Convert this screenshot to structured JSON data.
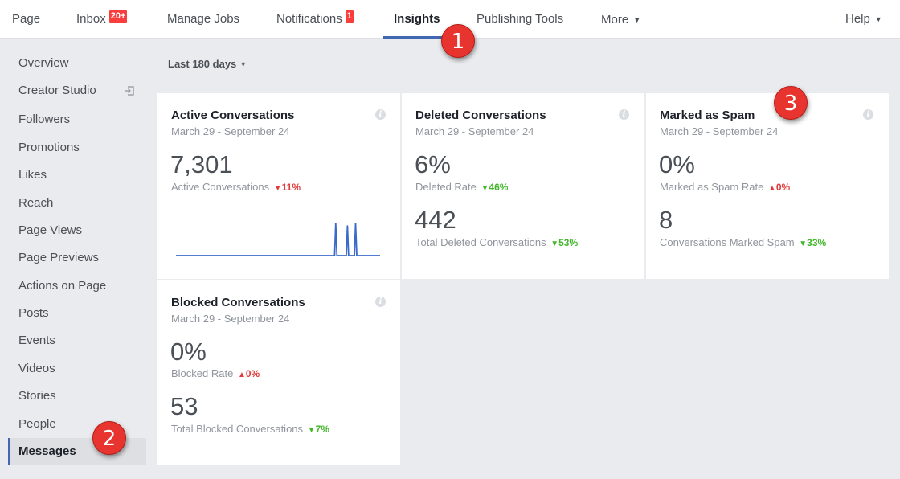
{
  "topnav": {
    "items": [
      {
        "label": "Page"
      },
      {
        "label": "Inbox",
        "badge": "20+"
      },
      {
        "label": "Manage Jobs"
      },
      {
        "label": "Notifications",
        "badge": "1"
      },
      {
        "label": "Insights",
        "active": true
      },
      {
        "label": "Publishing Tools"
      },
      {
        "label": "More"
      }
    ],
    "help": "Help"
  },
  "annotations": [
    "1",
    "2",
    "3"
  ],
  "sidebar": {
    "items": [
      {
        "label": "Overview"
      },
      {
        "label": "Creator Studio"
      },
      {
        "label": "Followers"
      },
      {
        "label": "Promotions"
      },
      {
        "label": "Likes"
      },
      {
        "label": "Reach"
      },
      {
        "label": "Page Views"
      },
      {
        "label": "Page Previews"
      },
      {
        "label": "Actions on Page"
      },
      {
        "label": "Posts"
      },
      {
        "label": "Events"
      },
      {
        "label": "Videos"
      },
      {
        "label": "Stories"
      },
      {
        "label": "People"
      },
      {
        "label": "Messages",
        "active": true
      }
    ]
  },
  "date_range": "Last 180 days",
  "cards": {
    "active": {
      "title": "Active Conversations",
      "date": "March 29 - September 24",
      "value": "7,301",
      "label": "Active Conversations",
      "change": "11%",
      "direction": "down",
      "sparkline": [
        0,
        0,
        0,
        0,
        0,
        0,
        0,
        0,
        0,
        0,
        0,
        0,
        0,
        0,
        0,
        0,
        0,
        0,
        0,
        0,
        0,
        0,
        0,
        0,
        0,
        0,
        0,
        0,
        0,
        0,
        0,
        0,
        0,
        0,
        0,
        0,
        0,
        0,
        0,
        0,
        0,
        0,
        0,
        0,
        0,
        0,
        0,
        0,
        0,
        0,
        0,
        0,
        0,
        0,
        0,
        0,
        0,
        0,
        0,
        0,
        0,
        0,
        0,
        0,
        0,
        0,
        0,
        0,
        0,
        0,
        0,
        0,
        0,
        0,
        0,
        0,
        0,
        0,
        0,
        0,
        0,
        0,
        0,
        0,
        0,
        0,
        0,
        0,
        0,
        0,
        0,
        0,
        0,
        0,
        0,
        0,
        0,
        0,
        0,
        0,
        0,
        0,
        0,
        0,
        0,
        0,
        0,
        0,
        0,
        0,
        0,
        0,
        0,
        0,
        0,
        0,
        0,
        0,
        0,
        0,
        0,
        0,
        0,
        0,
        0,
        0,
        0,
        0,
        0,
        0,
        0,
        0,
        0,
        0,
        0,
        0,
        0,
        38,
        0,
        0,
        0,
        0,
        0,
        0,
        0,
        0,
        0,
        35,
        0,
        0,
        0,
        0,
        0,
        0,
        38,
        0,
        0,
        0,
        0,
        0,
        0,
        0,
        0,
        0,
        0,
        0,
        0,
        0,
        0,
        0,
        0,
        0,
        0,
        0,
        0,
        0
      ]
    },
    "deleted": {
      "title": "Deleted Conversations",
      "date": "March 29 - September 24",
      "value1": "6%",
      "label1": "Deleted Rate",
      "change1": "46%",
      "value2": "442",
      "label2": "Total Deleted Conversations",
      "change2": "53%"
    },
    "spam": {
      "title": "Marked as Spam",
      "date": "March 29 - September 24",
      "value1": "0%",
      "label1": "Marked as Spam Rate",
      "change1": "0%",
      "value2": "8",
      "label2": "Conversations Marked Spam",
      "change2": "33%"
    },
    "blocked": {
      "title": "Blocked Conversations",
      "date": "March 29 - September 24",
      "value1": "0%",
      "label1": "Blocked Rate",
      "change1": "0%",
      "value2": "53",
      "label2": "Total Blocked Conversations",
      "change2": "7%"
    }
  },
  "info_icon": "i",
  "colors": {
    "accent": "#4267b2",
    "negative": "#e03a3a",
    "positive": "#42b72a",
    "sparkline": "#3b6bc9",
    "annotation": "#e8342f"
  }
}
